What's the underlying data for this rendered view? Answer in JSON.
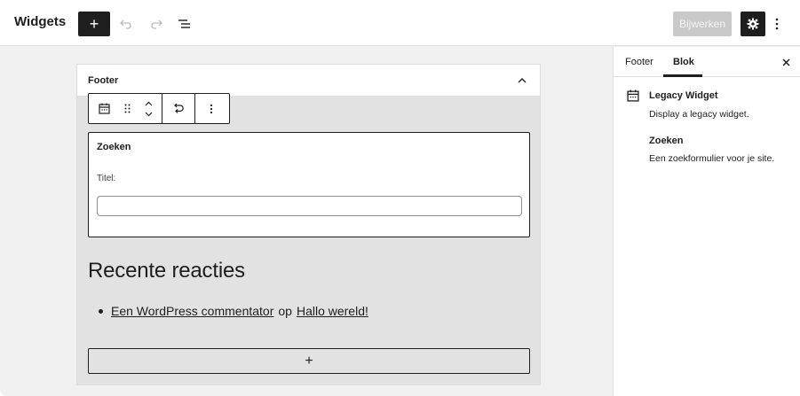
{
  "header": {
    "title": "Widgets",
    "add_label": "+",
    "publish_label": "Bijwerken",
    "icons": [
      "plus-icon",
      "undo-icon",
      "redo-icon",
      "list-view-icon",
      "gear-icon",
      "more-vertical-icon"
    ]
  },
  "canvas": {
    "area_title": "Footer",
    "legacy_widget": {
      "title": "Zoeken",
      "field_label": "Titel:",
      "field_value": ""
    },
    "recent_comments": {
      "heading": "Recente reacties",
      "items": [
        {
          "author": "Een WordPress commentator",
          "connector": "op",
          "post": "Hallo wereld!"
        }
      ]
    },
    "appender_label": "+"
  },
  "sidebar": {
    "tabs": [
      {
        "label": "Footer",
        "active": false
      },
      {
        "label": "Blok",
        "active": true
      }
    ],
    "block_card": {
      "title": "Legacy Widget",
      "description": "Display a legacy widget."
    },
    "widget": {
      "name": "Zoeken",
      "description": "Een zoekformulier voor je site."
    }
  },
  "colors": {
    "dark": "#1e1e1e",
    "canvas_bg": "#f0f0f0",
    "area_bg": "#e2e2e2",
    "disabled_button": "#c9c9c9"
  }
}
